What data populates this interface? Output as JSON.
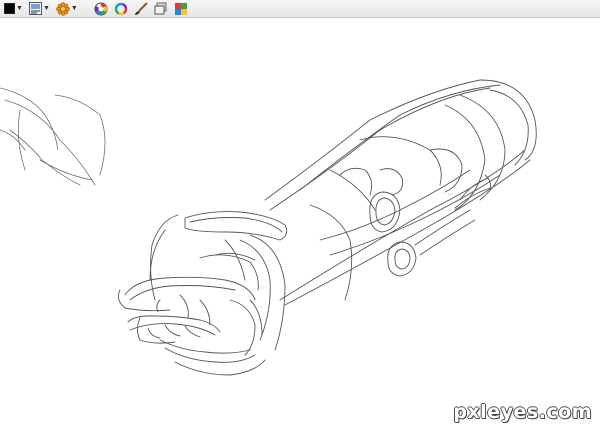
{
  "toolbar": {
    "tools": [
      {
        "name": "color-swatch",
        "icon": "black-square-icon",
        "color": "#000000"
      },
      {
        "name": "brush-preset",
        "icon": "brush-preset-icon"
      },
      {
        "name": "brush-shape",
        "icon": "gear-flower-icon",
        "color": "#e8901a"
      },
      {
        "name": "color-picker",
        "icon": "color-wheel-icon"
      },
      {
        "name": "hue-ring",
        "icon": "hue-ring-icon"
      },
      {
        "name": "paintbrush",
        "icon": "paintbrush-icon"
      },
      {
        "name": "layers",
        "icon": "layers-icon"
      },
      {
        "name": "palette",
        "icon": "palette-icon"
      }
    ]
  },
  "canvas": {
    "background": "#ffffff",
    "stroke_color": "#3a3a3a"
  },
  "watermark": {
    "text": "pxleyes.com"
  }
}
